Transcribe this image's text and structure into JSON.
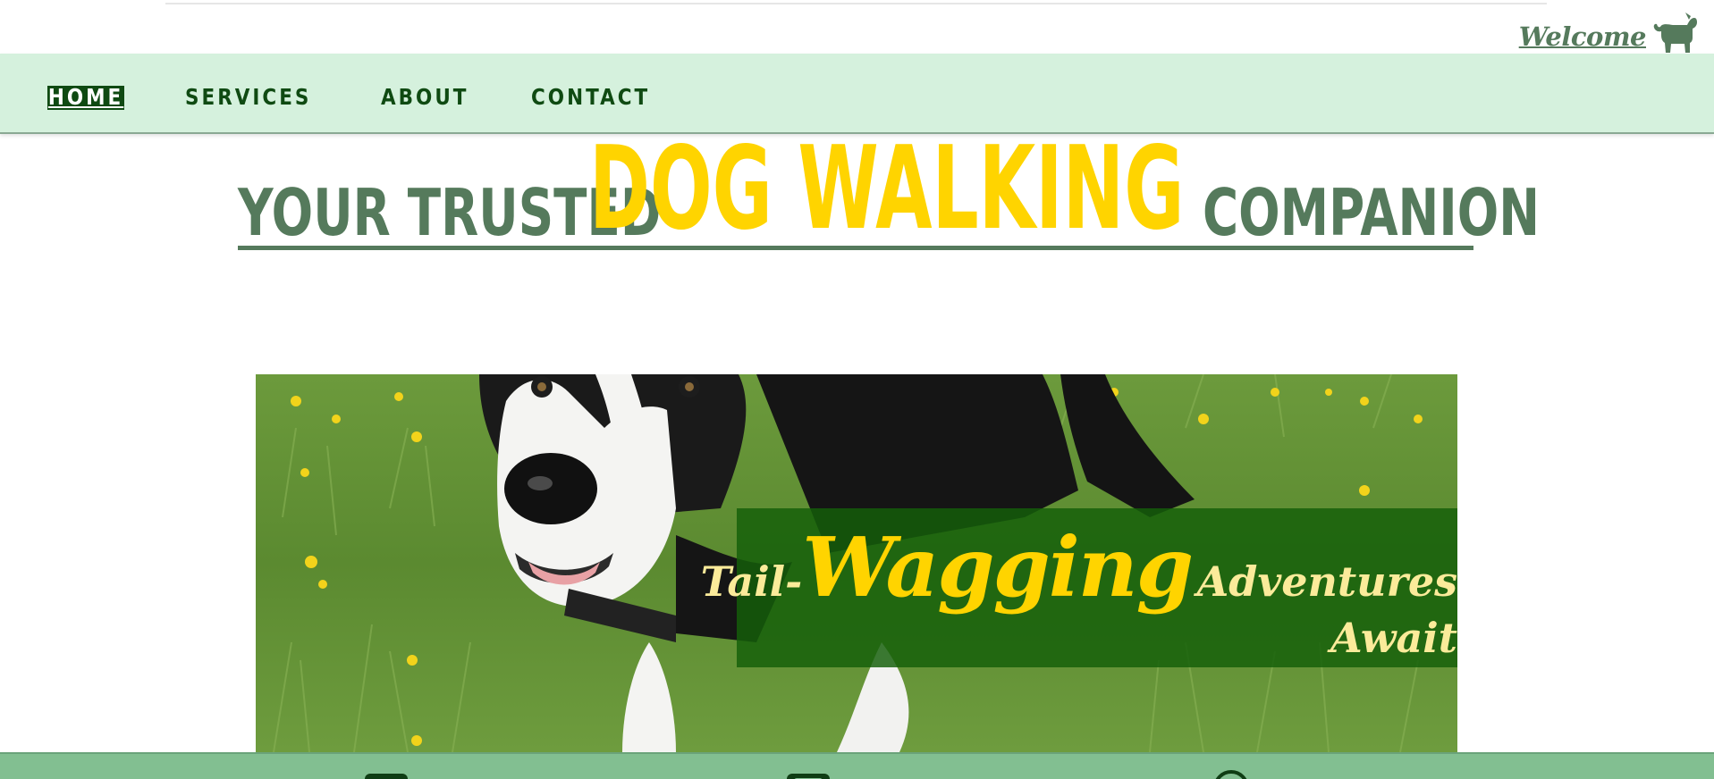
{
  "header": {
    "welcome_label": "Welcome",
    "welcome_icon": "dog-icon"
  },
  "nav": {
    "items": [
      {
        "label": "HOME",
        "active": true
      },
      {
        "label": "SERVICES",
        "active": false
      },
      {
        "label": "ABOUT",
        "active": false
      },
      {
        "label": "CONTACT",
        "active": false
      }
    ]
  },
  "headline": {
    "part1": "YOUR TRUSTED",
    "part2": "DOG WALKING",
    "part3": "COMPANION"
  },
  "hero": {
    "image": "black-and-white-dog-on-grass",
    "banner": {
      "tail": "Tail-",
      "wagging": "Wagging",
      "adventures": "Adventures",
      "await": "Await"
    }
  },
  "footer": {
    "icons": [
      "facebook-icon",
      "instagram-icon",
      "location-icon"
    ]
  },
  "colors": {
    "nav_background": "#d5f1dd",
    "nav_text": "#0f4a12",
    "headline_green": "#557a5c",
    "headline_yellow": "#ffd400",
    "banner_background": "#145f0a",
    "banner_text": "#fbeb9a",
    "footer_background": "#82bf91"
  }
}
